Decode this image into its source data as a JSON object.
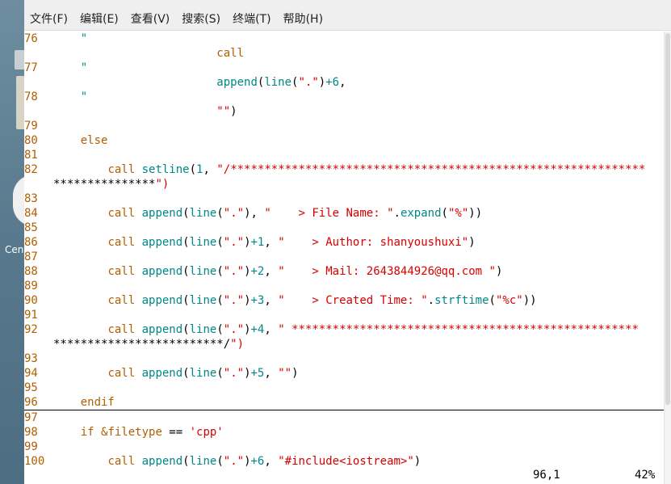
{
  "desktop": {
    "label": "Cen"
  },
  "menu": [
    "文件(F)",
    "编辑(E)",
    "查看(V)",
    "搜索(S)",
    "终端(T)",
    "帮助(H)"
  ],
  "lines": [
    {
      "n": "76",
      "t": "    \""
    },
    {
      "n": "",
      "t": "                        call"
    },
    {
      "n": "77",
      "t": "    \""
    },
    {
      "n": "",
      "t": "                        append(line(\".\")+6,"
    },
    {
      "n": "78",
      "t": "    \""
    },
    {
      "n": "",
      "t": "                        \"\")"
    },
    {
      "n": "79",
      "t": ""
    },
    {
      "n": "80",
      "t": "    else"
    },
    {
      "n": "81",
      "t": ""
    },
    {
      "n": "82",
      "t": "        call setline(1, \"/*************************************************************"
    },
    {
      "n": "",
      "t": "***************\")"
    },
    {
      "n": "83",
      "t": ""
    },
    {
      "n": "84",
      "t": "        call append(line(\".\"), \"    > File Name: \".expand(\"%\"))"
    },
    {
      "n": "85",
      "t": ""
    },
    {
      "n": "86",
      "t": "        call append(line(\".\")+1, \"    > Author: shanyoushuxi\")"
    },
    {
      "n": "87",
      "t": ""
    },
    {
      "n": "88",
      "t": "        call append(line(\".\")+2, \"    > Mail: 2643844926@qq.com \")"
    },
    {
      "n": "89",
      "t": ""
    },
    {
      "n": "90",
      "t": "        call append(line(\".\")+3, \"    > Created Time: \".strftime(\"%c\"))"
    },
    {
      "n": "91",
      "t": ""
    },
    {
      "n": "92",
      "t": "        call append(line(\".\")+4, \" ***************************************************"
    },
    {
      "n": "",
      "t": "*************************/\")"
    },
    {
      "n": "93",
      "t": ""
    },
    {
      "n": "94",
      "t": "        call append(line(\".\")+5, \"\")"
    },
    {
      "n": "95",
      "t": ""
    },
    {
      "n": "96",
      "t": "    endif"
    },
    {
      "n": "97",
      "t": ""
    },
    {
      "n": "98",
      "t": "    if &filetype == 'cpp'"
    },
    {
      "n": "99",
      "t": ""
    },
    {
      "n": "100",
      "t": "        call append(line(\".\")+6, \"#include<iostream>\")"
    }
  ],
  "status": {
    "position": "96,1",
    "percent": "42%"
  }
}
